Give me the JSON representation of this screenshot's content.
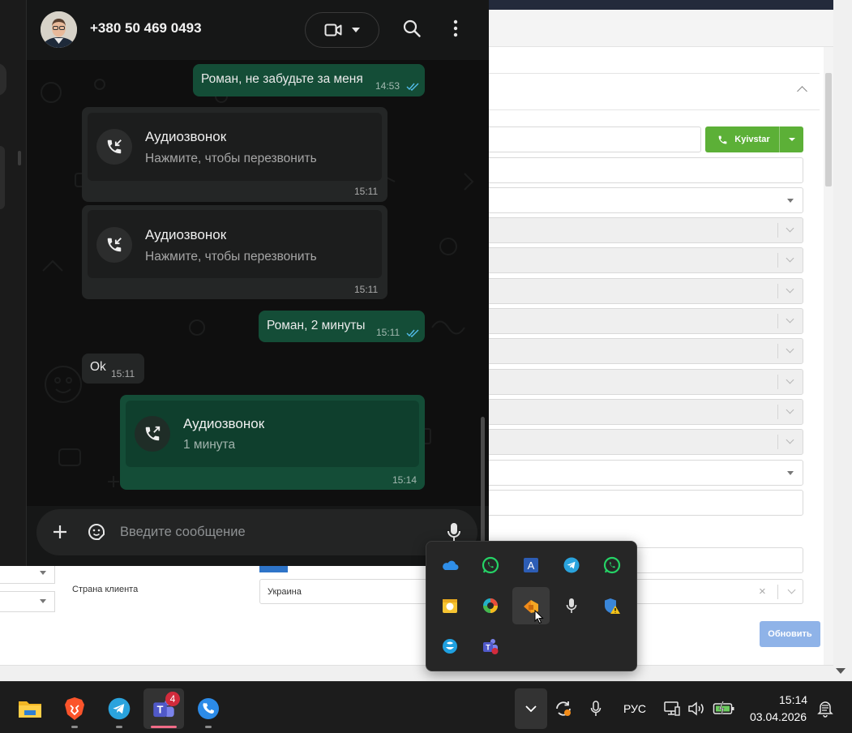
{
  "whatsapp": {
    "contact_name": "+380 50 469 0493",
    "messages": [
      {
        "text": "Роман, не забудьте за меня",
        "time": "14:53"
      },
      {
        "title": "Аудиозвонок",
        "subtitle": "Нажмите, чтобы перезвонить",
        "time": "15:11"
      },
      {
        "title": "Аудиозвонок",
        "subtitle": "Нажмите, чтобы перезвонить",
        "time": "15:11"
      },
      {
        "text": "Роман, 2 минуты",
        "time": "15:11"
      },
      {
        "text": "Ok",
        "time": "15:11"
      },
      {
        "title": "Аудиозвонок",
        "subtitle": "1 минута",
        "time": "15:14"
      }
    ],
    "input_placeholder": "Введите сообщение"
  },
  "crm": {
    "operator_button": "Kyivstar",
    "country_label": "Страна клиента",
    "country_value": "Украина",
    "update_button": "Обновить"
  },
  "tray_icons": [
    "onedrive-icon",
    "whatsapp-icon",
    "text-tool-icon",
    "telegram-icon",
    "whatsapp-business-icon",
    "calendar-icon",
    "edge-canary-icon",
    "app-orange-icon",
    "microphone-icon",
    "defender-warning-icon",
    "skype-icon",
    "teams-icon"
  ],
  "taskbar": {
    "apps": [
      "file-explorer-icon",
      "brave-icon",
      "telegram-icon",
      "teams-icon",
      "phone-icon"
    ],
    "teams_badge": "4",
    "language": "РУС",
    "time": "15:14",
    "date": "03.04.2026"
  },
  "colors": {
    "wa_outgoing": "#144d37",
    "wa_incoming": "#242626",
    "accent_green": "#5cb037",
    "update_blue": "#8fb3e8"
  }
}
